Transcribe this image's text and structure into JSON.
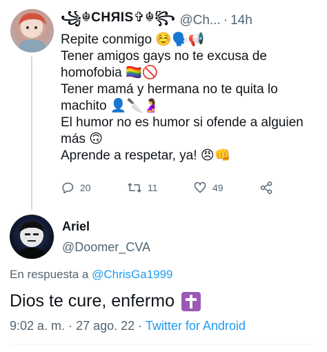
{
  "tweet1": {
    "display_name": "꧁☬CHЯIS✞☬꧂",
    "handle": "@Ch...",
    "time": "14h",
    "lines": [
      "Repite conmigo ☺️🗣️📢",
      "Tener amigos gays no te excusa de",
      "homofobia 🏳️‍🌈🚫",
      "Tener mamá y hermana no te quita lo",
      "machito 👤🔪🤰",
      "El humor no es humor si ofende a alguien",
      "más 🙃",
      "Aprende a respetar, ya! 😠👊"
    ],
    "actions": {
      "replies": "20",
      "retweets": "11",
      "likes": "49"
    },
    "icons": [
      "reply-icon",
      "retweet-icon",
      "like-icon",
      "share-icon"
    ]
  },
  "tweet2": {
    "display_name": "Ariel",
    "handle": "@Doomer_CVA",
    "reply_prefix": "En respuesta a",
    "reply_handle": "@ChrisGa1999",
    "text": "Dios te cure, enfermo",
    "time": "9:02 a. m.",
    "date": "27 ago. 22",
    "source": "Twitter for Android"
  },
  "colors": {
    "link": "#1d9bf0",
    "muted": "#536471",
    "text": "#0f1419",
    "cross_bg": "#9b59b6"
  }
}
